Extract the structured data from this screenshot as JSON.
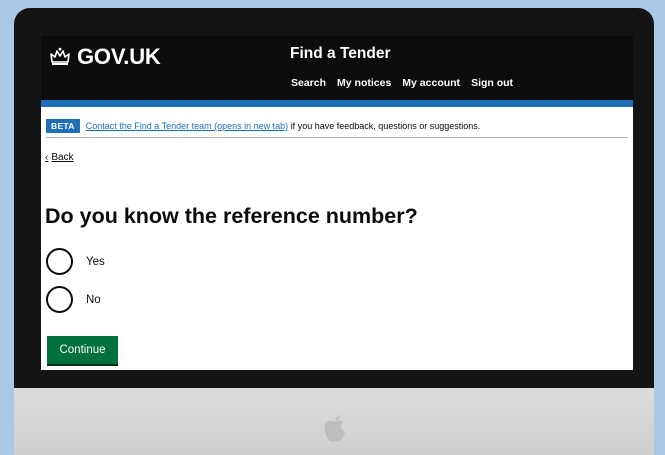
{
  "header": {
    "logo_text": "GOV.UK",
    "service_name": "Find a Tender",
    "nav": [
      "Search",
      "My notices",
      "My account",
      "Sign out"
    ]
  },
  "phase_banner": {
    "tag": "BETA",
    "link_text": "Contact the Find a Tender team (opens in new tab)",
    "text": "if you have feedback, questions or suggestions."
  },
  "back_link": {
    "label": "Back"
  },
  "question": {
    "title": "Do you know the reference number?"
  },
  "options": [
    {
      "label": "Yes",
      "selected": false
    },
    {
      "label": "No",
      "selected": false
    }
  ],
  "continue_button": {
    "label": "Continue"
  },
  "colors": {
    "header_bg": "#0b0c0c",
    "accent_blue": "#1d70b8",
    "button_green": "#00703c",
    "backdrop": "#a9c8e6"
  }
}
